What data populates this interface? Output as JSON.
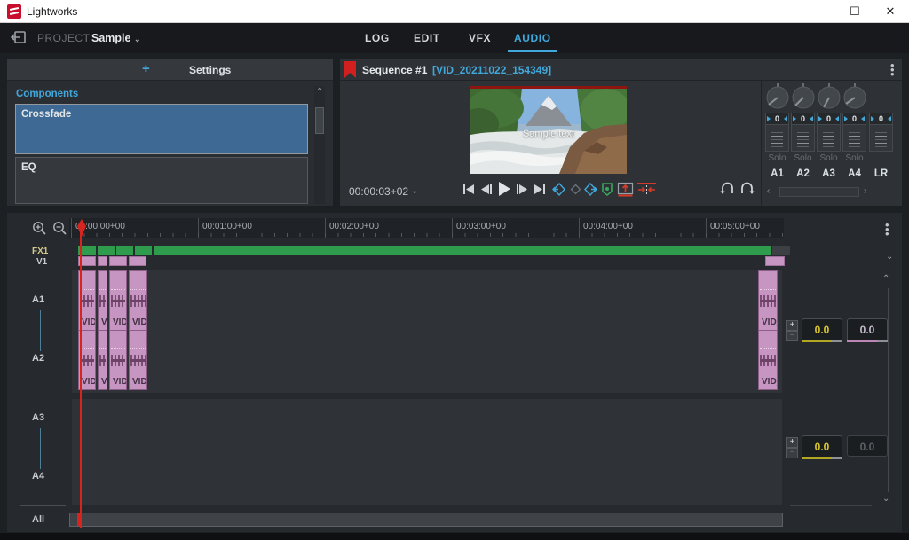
{
  "titlebar": {
    "app_name": "Lightworks",
    "minimize": "–",
    "maximize": "☐",
    "close": "✕"
  },
  "nav": {
    "project_label": "PROJECT",
    "project_name": "Sample",
    "dropdown_chevron": "⌄",
    "tabs": [
      {
        "label": "LOG"
      },
      {
        "label": "EDIT"
      },
      {
        "label": "VFX"
      },
      {
        "label": "AUDIO"
      }
    ]
  },
  "left_panel": {
    "add_button": "+",
    "settings_label": "Settings",
    "components_label": "Components",
    "items": [
      {
        "label": "Crossfade"
      },
      {
        "label": "EQ"
      }
    ]
  },
  "sequence": {
    "title": "Sequence #1",
    "clip_ref": "[VID_20211022_154349]",
    "video_overlay": "Sample text",
    "timecode": "00:00:03+02"
  },
  "mixer": {
    "channels": [
      {
        "label": "A1",
        "value": "0",
        "solo": "Solo"
      },
      {
        "label": "A2",
        "value": "0",
        "solo": "Solo"
      },
      {
        "label": "A3",
        "value": "0",
        "solo": "Solo"
      },
      {
        "label": "A4",
        "value": "0",
        "solo": "Solo"
      },
      {
        "label": "LR",
        "value": "0"
      }
    ]
  },
  "timeline": {
    "ruler_labels": [
      "00:00:00+00",
      "00:01:00+00",
      "00:02:00+00",
      "00:03:00+00",
      "00:04:00+00",
      "00:05:00+00"
    ],
    "tracks": {
      "fx": "FX1",
      "v": "V1",
      "a1": "A1",
      "a2": "A2",
      "a3": "A3",
      "a4": "A4",
      "all": "All"
    },
    "clip_label": "VID_"
  },
  "volume": {
    "rows": [
      {
        "left": "0.0",
        "right": "0.0"
      },
      {
        "left": "0.0",
        "right": "0.0"
      }
    ]
  },
  "colors": {
    "accent_blue": "#41a8dc",
    "green_clip": "#2f9b4c",
    "pink_clip": "#c795c1",
    "playhead_red": "#d42520",
    "value_yellow": "#d8c72e"
  }
}
